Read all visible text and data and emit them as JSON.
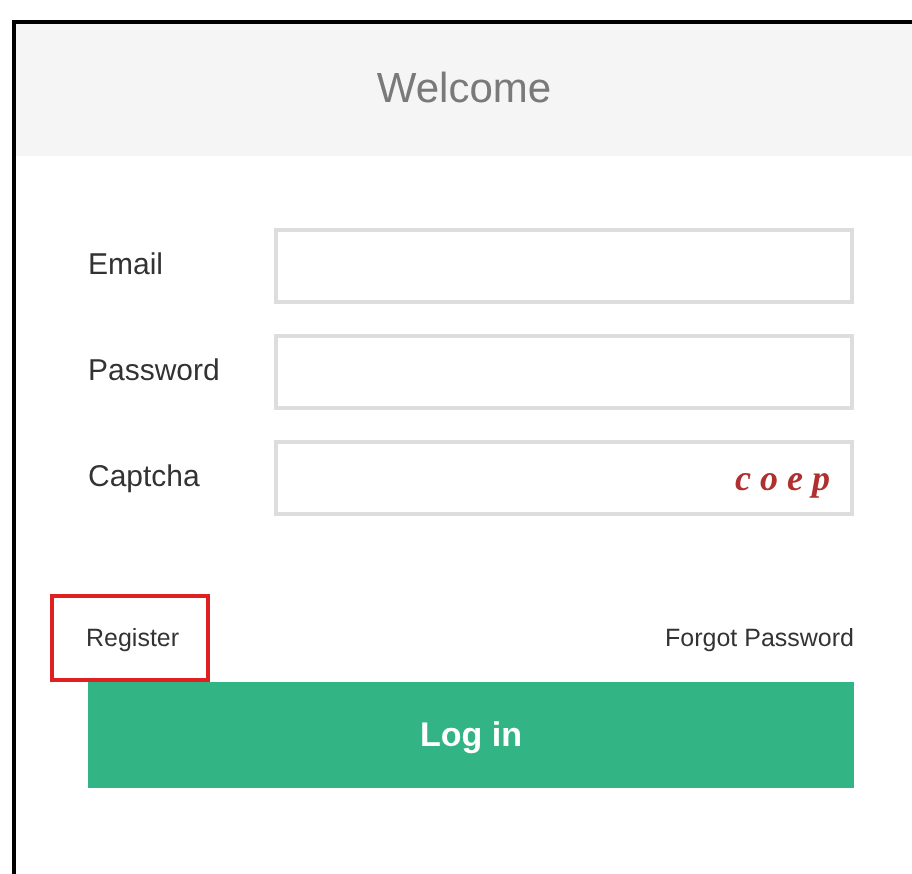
{
  "header": {
    "title": "Welcome"
  },
  "fields": [
    {
      "label": "Email",
      "kind": "text"
    },
    {
      "label": "Password",
      "kind": "password"
    },
    {
      "label": "Captcha",
      "kind": "captcha",
      "captcha": "c o e p"
    }
  ],
  "links": {
    "register": {
      "label": "Register",
      "highlighted": true
    },
    "forgot": {
      "label": "Forgot Password"
    }
  },
  "buttons": [
    {
      "label": "Log in"
    }
  ]
}
